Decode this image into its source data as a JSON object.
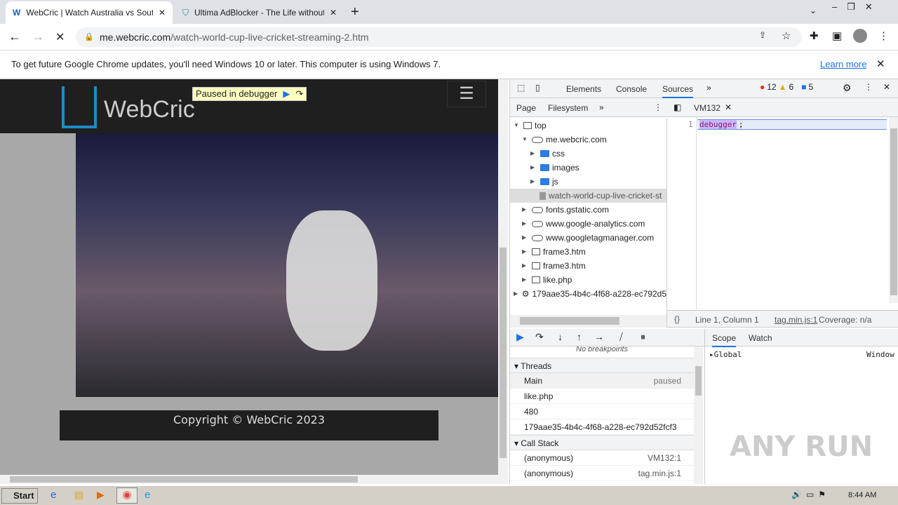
{
  "tabs": [
    {
      "title": "WebCric | Watch Australia vs South"
    },
    {
      "title": "Ultima AdBlocker - The Life without A"
    }
  ],
  "address": {
    "host": "me.webcric.com",
    "path": "/watch-world-cup-live-cricket-streaming-2.htm"
  },
  "infobar": {
    "message": "To get future Google Chrome updates, you'll need Windows 10 or later. This computer is using Windows 7.",
    "link": "Learn more"
  },
  "site": {
    "logo": "WebCric",
    "paused": "Paused in debugger",
    "footer": "Copyright © WebCric 2023"
  },
  "devtools": {
    "tabs": [
      "Elements",
      "Console",
      "Sources"
    ],
    "errors": "12",
    "warnings": "6",
    "messages": "5",
    "nav_tabs": [
      "Page",
      "Filesystem"
    ],
    "tree": [
      "top",
      "me.webcric.com",
      "css",
      "images",
      "js",
      "watch-world-cup-live-cricket-st",
      "fonts.gstatic.com",
      "www.google-analytics.com",
      "www.googletagmanager.com",
      "frame3.htm",
      "frame3.htm",
      "like.php",
      "179aae35-4b4c-4f68-a228-ec792d5"
    ],
    "file_tab": "VM132",
    "line_no": "1",
    "code": "debugger",
    "code_end": ";",
    "status": {
      "position": "Line 1, Column 1",
      "source": "tag.min.js:1",
      "coverage": "Coverage: n/a"
    },
    "no_breakpoints": "No breakpoints",
    "threads_title": "Threads",
    "threads": [
      {
        "name": "Main",
        "state": "paused"
      },
      {
        "name": "like.php",
        "state": ""
      },
      {
        "name": "480",
        "state": ""
      },
      {
        "name": "179aae35-4b4c-4f68-a228-ec792d52fcf3",
        "state": ""
      }
    ],
    "callstack_title": "Call Stack",
    "callstack": [
      {
        "name": "(anonymous)",
        "loc": "VM132:1"
      },
      {
        "name": "(anonymous)",
        "loc": "tag.min.js:1"
      }
    ],
    "scope_tabs": [
      "Scope",
      "Watch"
    ],
    "scope": {
      "name": "Global",
      "value": "Window"
    }
  },
  "taskbar": {
    "start": "Start",
    "time": "8:44 AM"
  },
  "watermark": "ANY RUN"
}
